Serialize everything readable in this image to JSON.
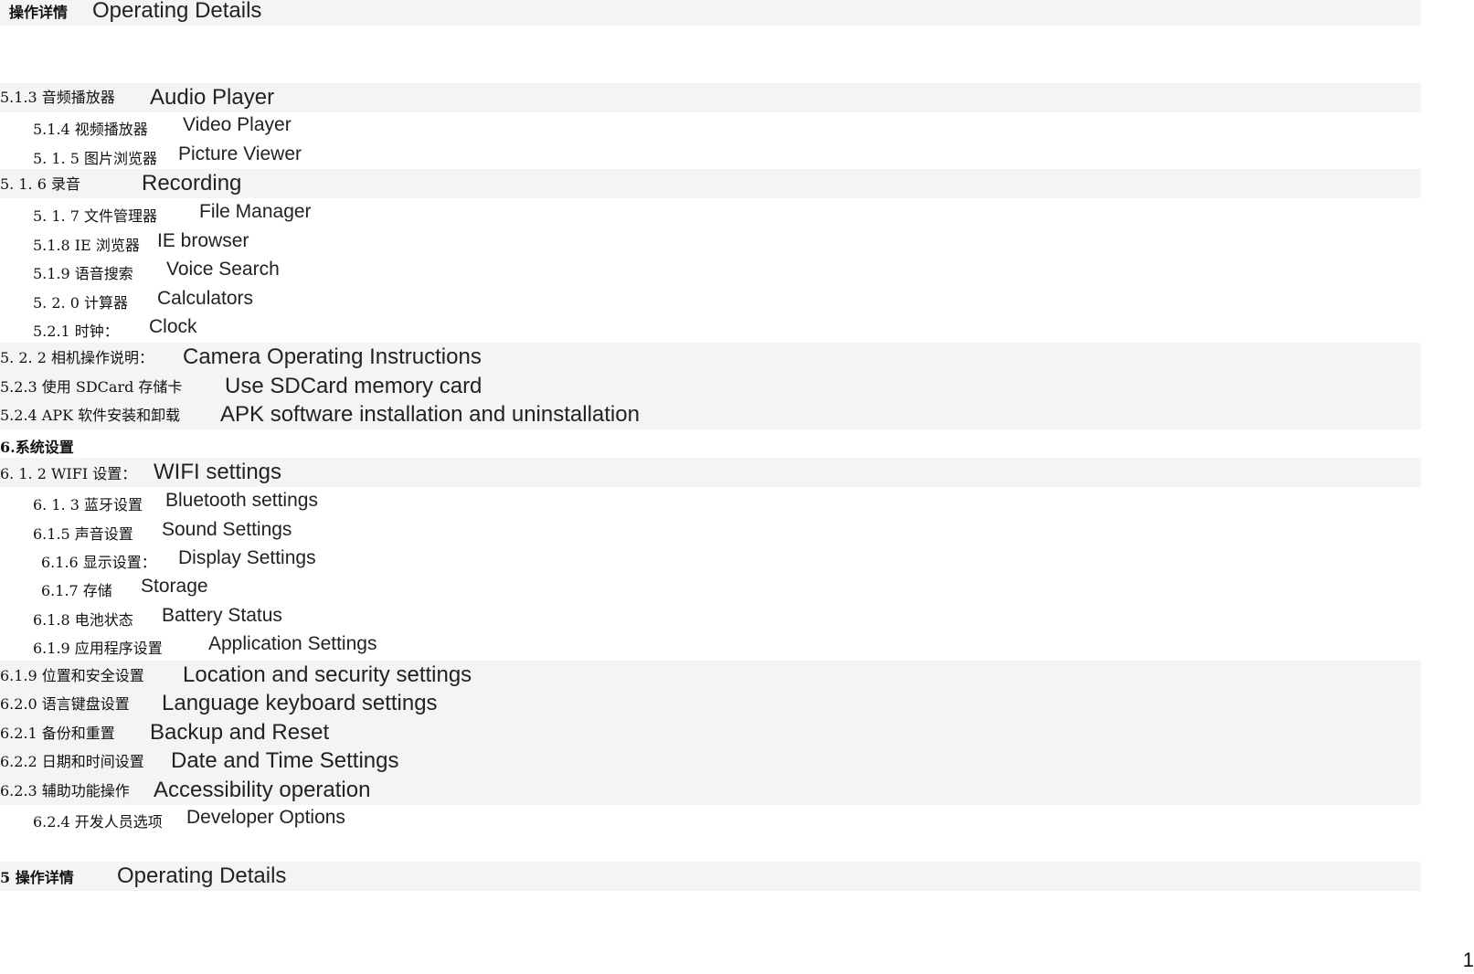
{
  "header": {
    "zh": "操作详情",
    "en": "Operating Details"
  },
  "items": [
    {
      "zh": "5.1.3  音频播放器",
      "en": "Audio Player"
    },
    {
      "zh": "5.1.4  视频播放器",
      "en": "Video Player"
    },
    {
      "zh": "5. 1. 5 图片浏览器",
      "en": "Picture Viewer"
    },
    {
      "zh": "5. 1. 6  录音",
      "en": "Recording"
    },
    {
      "zh": "5. 1. 7  文件管理器",
      "en": "File Manager"
    },
    {
      "zh": "5.1.8 IE 浏览器",
      "en": "IE browser"
    },
    {
      "zh": "5.1.9  语音搜索",
      "en": "Voice Search"
    },
    {
      "zh": "5. 2. 0  计算器",
      "en": "Calculators"
    },
    {
      "zh": "5.2.1  时钟：",
      "en": "Clock"
    },
    {
      "zh": "5. 2. 2  相机操作说明：",
      "en": "Camera Operating Instructions"
    },
    {
      "zh": "5.2.3    使用 SDCard 存储卡",
      "en": "Use SDCard memory card"
    },
    {
      "zh": "5.2.4    APK 软件安装和卸载",
      "en": "APK software installation and uninstallation"
    }
  ],
  "section6": {
    "title": "6.系统设置"
  },
  "items6": [
    {
      "zh": "6. 1. 2 WIFI 设置：",
      "en": "WIFI settings"
    },
    {
      "zh": "6. 1. 3  蓝牙设置",
      "en": "Bluetooth settings"
    },
    {
      "zh": "6.1.5 声音设置",
      "en": "Sound Settings"
    },
    {
      "zh": "6.1.6 显示设置：",
      "en": "Display Settings"
    },
    {
      "zh": "6.1.7  存储",
      "en": "Storage"
    },
    {
      "zh": "6.1.8 电池状态",
      "en": "Battery Status"
    },
    {
      "zh": "6.1.9    应用程序设置",
      "en": "Application Settings"
    },
    {
      "zh": "6.1.9    位置和安全设置",
      "en": "Location and security settings"
    },
    {
      "zh": "6.2.0 语言键盘设置",
      "en": "Language keyboard settings"
    },
    {
      "zh": "6.2.1    备份和重置",
      "en": "Backup and Reset"
    },
    {
      "zh": "6.2.2 日期和时间设置",
      "en": "Date and Time Settings"
    },
    {
      "zh": "6.2.3 辅助功能操作",
      "en": "Accessibility operation"
    },
    {
      "zh": "6.2.4 开发人员选项",
      "en": "Developer Options"
    }
  ],
  "footer": {
    "zh": "5  操作详情",
    "en": "Operating Details"
  },
  "page_number": "1"
}
